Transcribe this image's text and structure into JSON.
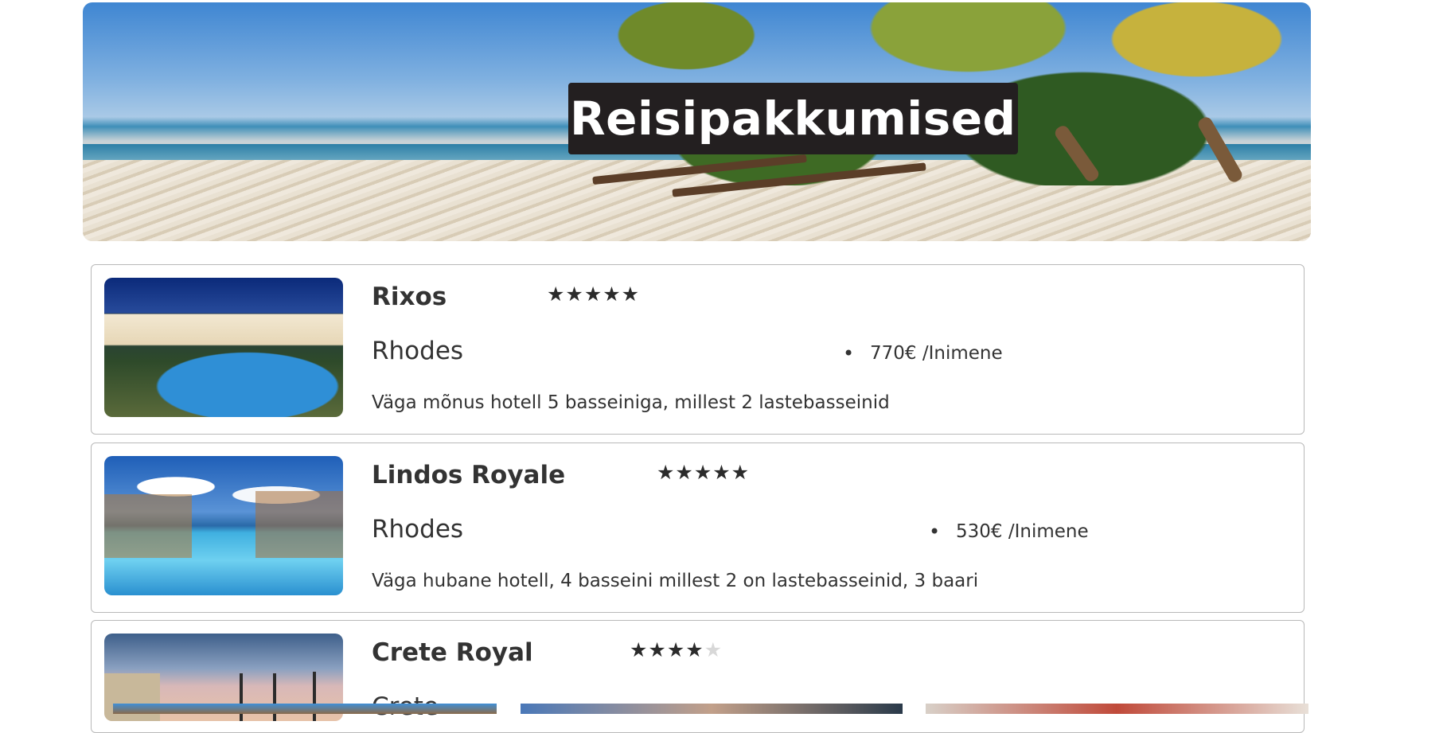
{
  "hero": {
    "title": "Reisipakkumised"
  },
  "hotels": [
    {
      "name": "Rixos",
      "stars": "★★★★★",
      "stars_off": "",
      "rating": 5,
      "location": "Rhodes",
      "price": "770€ /Inimene",
      "description": "Väga mõnus hotell 5 basseiniga, millest 2 lastebasseinid"
    },
    {
      "name": "Lindos Royale",
      "stars": "★★★★★",
      "stars_off": "",
      "rating": 5,
      "location": "Rhodes",
      "price": "530€ /Inimene",
      "description": "Väga hubane hotell, 4 basseini millest 2 on lastebasseinid, 3 baari"
    },
    {
      "name": "Crete Royal",
      "stars": "★★★★",
      "stars_off": "★",
      "rating": 4,
      "location": "Crete"
    }
  ]
}
